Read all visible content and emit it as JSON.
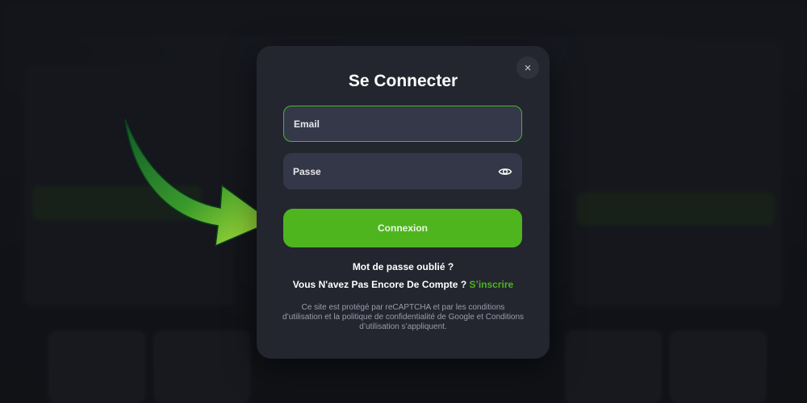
{
  "modal": {
    "title": "Se Connecter",
    "close_icon": "×",
    "email_placeholder": "Email",
    "password_placeholder": "Passe",
    "eye_icon": "eye-icon",
    "submit_label": "Connexion",
    "forgot_label": "Mot de passe oublié ?",
    "no_account_text": "Vous N'avez Pas Encore De Compte ?",
    "signup_label": "S’inscrire",
    "legal_text": "Ce site est protégé par reCAPTCHA et par les conditions d’utilisation et la politique de confidentialité de Google et Conditions d’utilisation s’appliquent."
  },
  "colors": {
    "accent": "#4eb51f",
    "modal_bg": "#23262f",
    "field_bg": "#343747"
  }
}
